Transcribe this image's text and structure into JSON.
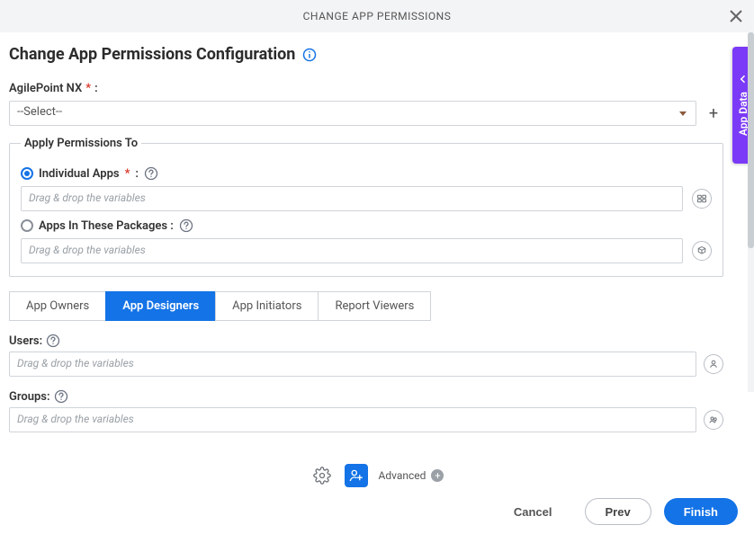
{
  "header": {
    "title": "CHANGE APP PERMISSIONS"
  },
  "sideDrawer": {
    "label": "App Data"
  },
  "page": {
    "title": "Change App Permissions Configuration"
  },
  "ap_nx": {
    "label": "AgilePoint NX",
    "req": "*",
    "colon": ":",
    "selected": "--Select--"
  },
  "applyTo": {
    "legend": "Apply Permissions To",
    "individual": {
      "label": "Individual Apps",
      "req": "*",
      "colon": " :"
    },
    "packages": {
      "label": "Apps In These Packages :",
      "colon": ""
    },
    "placeholder": "Drag & drop the variables"
  },
  "tabs": {
    "owners": "App Owners",
    "designers": "App Designers",
    "initiators": "App Initiators",
    "reports": "Report Viewers"
  },
  "users": {
    "label": "Users:",
    "placeholder": "Drag & drop the variables"
  },
  "groups": {
    "label": "Groups:",
    "placeholder": "Drag & drop the variables"
  },
  "settings": {
    "advanced": "Advanced"
  },
  "footer": {
    "cancel": "Cancel",
    "prev": "Prev",
    "finish": "Finish"
  }
}
